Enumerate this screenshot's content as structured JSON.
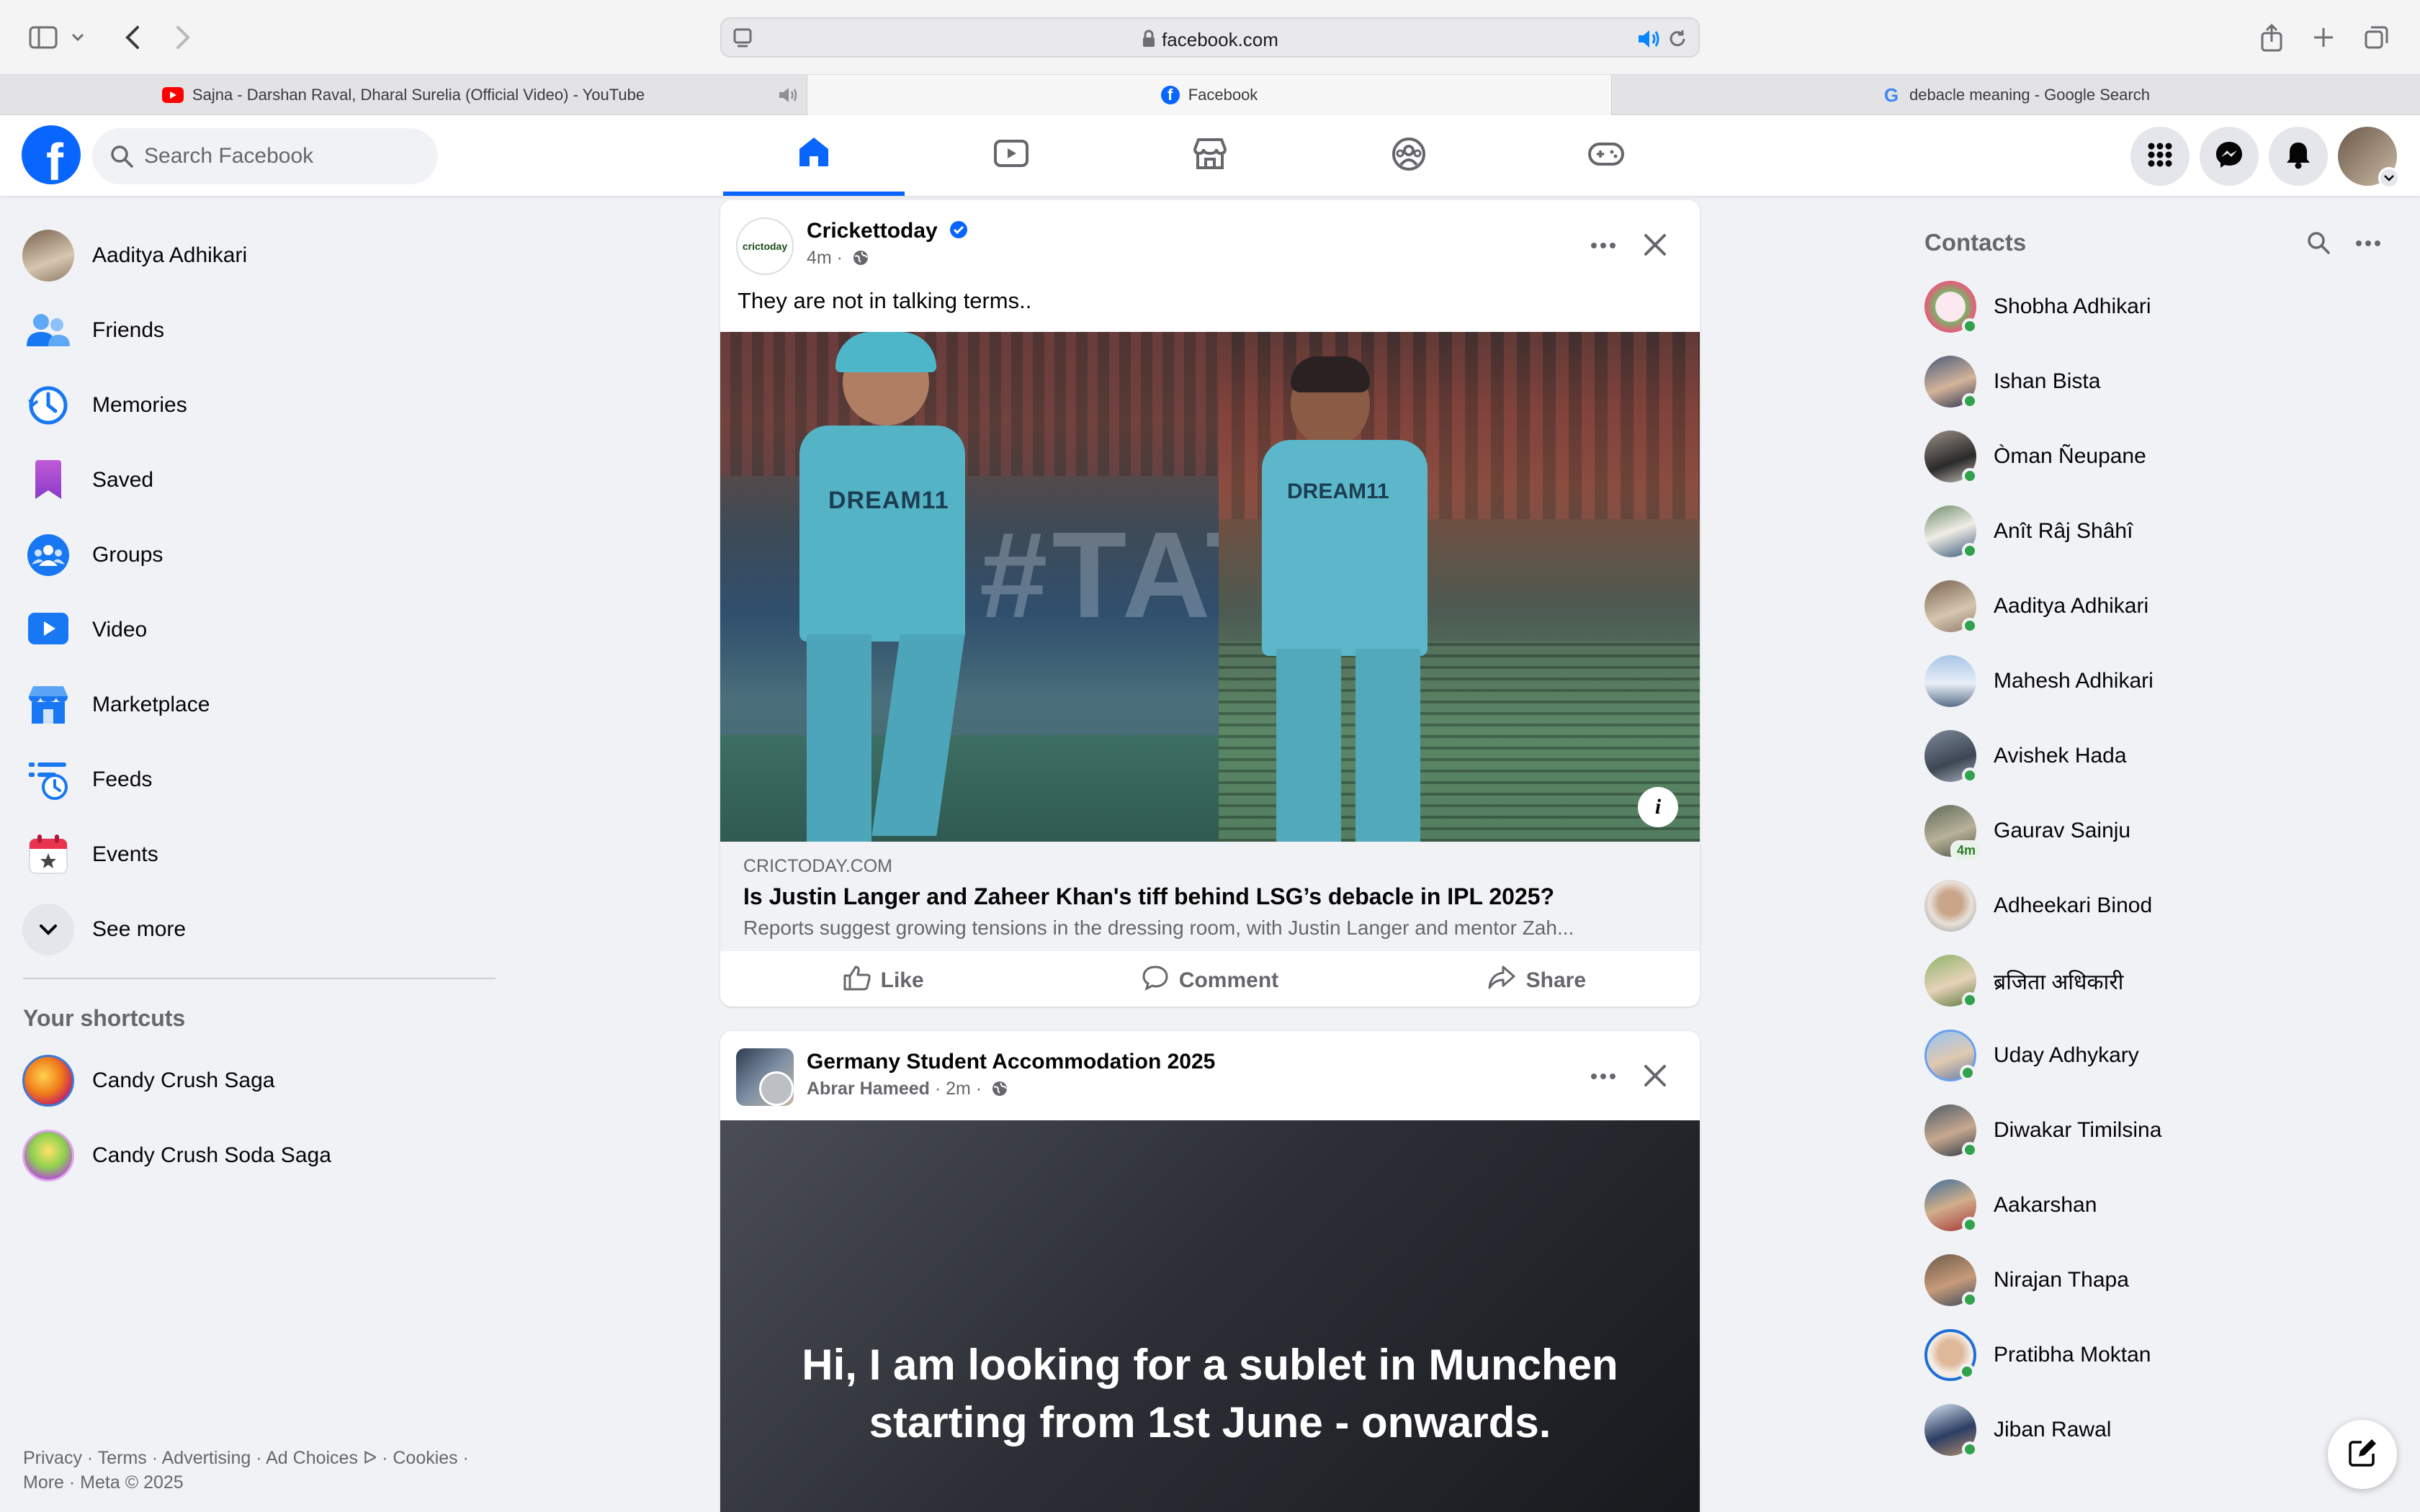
{
  "browser": {
    "url": "facebook.com",
    "tabs": [
      {
        "title": "Sajna - Darshan Raval, Dharal Surelia (Official Video) - YouTube",
        "favicon": "youtube-icon"
      },
      {
        "title": "Facebook",
        "favicon": "facebook-icon"
      },
      {
        "title": "debacle meaning - Google Search",
        "favicon": "google-icon"
      }
    ]
  },
  "header": {
    "search_placeholder": "Search Facebook",
    "nav": [
      "home-icon",
      "video-icon",
      "marketplace-icon",
      "groups-icon",
      "gaming-icon"
    ],
    "brand_color": "#0866ff"
  },
  "sidebar": {
    "items": [
      {
        "label": "Aaditya Adhikari",
        "icon": "profile-avatar"
      },
      {
        "label": "Friends",
        "icon": "friends-icon"
      },
      {
        "label": "Memories",
        "icon": "memories-icon"
      },
      {
        "label": "Saved",
        "icon": "saved-icon"
      },
      {
        "label": "Groups",
        "icon": "groups-icon"
      },
      {
        "label": "Video",
        "icon": "video-icon"
      },
      {
        "label": "Marketplace",
        "icon": "marketplace-icon"
      },
      {
        "label": "Feeds",
        "icon": "feeds-icon"
      },
      {
        "label": "Events",
        "icon": "events-icon"
      },
      {
        "label": "See more",
        "icon": "chevron-down-icon"
      }
    ],
    "shortcuts_heading": "Your shortcuts",
    "shortcuts": [
      {
        "label": "Candy Crush Saga"
      },
      {
        "label": "Candy Crush Soda Saga"
      }
    ],
    "footer": "Privacy · Terms · Advertising · Ad Choices ᐅ · Cookies · More · Meta © 2025"
  },
  "posts": [
    {
      "page_name": "Crickettoday",
      "avatar_text": "crictoday",
      "time": "4m ·",
      "text": "They are not in talking terms..",
      "link_domain": "CRICTODAY.COM",
      "link_title": "Is Justin Langer and Zaheer Khan's tiff behind LSG’s debacle in IPL 2025?",
      "link_desc": "Reports suggest growing tensions in the dressing room, with Justin Langer and mentor Zah...",
      "actions": [
        "Like",
        "Comment",
        "Share"
      ]
    },
    {
      "group_name": "Germany Student Accommodation 2025",
      "author": "Abrar Hameed",
      "time": "· 2m ·",
      "text_post": "Hi, I am looking for a sublet in Munchen starting from 1st June - onwards."
    }
  ],
  "contacts": {
    "title": "Contacts",
    "list": [
      {
        "name": "Shobha Adhikari"
      },
      {
        "name": "Ishan Bista"
      },
      {
        "name": "Òman Ñeupane"
      },
      {
        "name": "Anît Râj Shâhî"
      },
      {
        "name": "Aaditya Adhikari"
      },
      {
        "name": "Mahesh Adhikari"
      },
      {
        "name": "Avishek Hada"
      },
      {
        "name": "Gaurav Sainju",
        "badge": "4m"
      },
      {
        "name": "Adheekari Binod"
      },
      {
        "name": "ब्रजिता अधिकारी"
      },
      {
        "name": "Uday Adhykary"
      },
      {
        "name": "Diwakar Timilsina"
      },
      {
        "name": "Aakarshan"
      },
      {
        "name": "Nirajan Thapa"
      },
      {
        "name": "Pratibha Moktan"
      },
      {
        "name": "Jiban Rawal"
      }
    ]
  }
}
